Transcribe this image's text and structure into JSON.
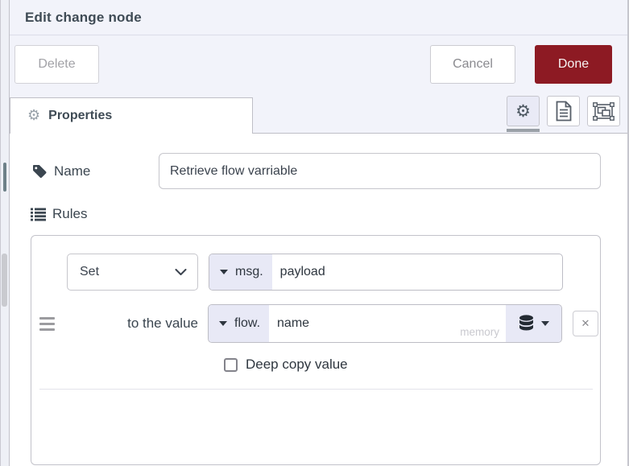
{
  "window": {
    "title": "Edit change node"
  },
  "actions": {
    "delete": "Delete",
    "cancel": "Cancel",
    "done": "Done"
  },
  "tabs": {
    "properties": "Properties"
  },
  "form": {
    "name": {
      "label": "Name",
      "value": "Retrieve flow varriable"
    },
    "rules": {
      "label": "Rules"
    }
  },
  "rule": {
    "action": "Set",
    "target_prefix": "msg.",
    "target_value": "payload",
    "to_label": "to the value",
    "source_prefix": "flow.",
    "source_value": "name",
    "store_hint": "memory",
    "deep_copy_label": "Deep copy value",
    "deep_copy_checked": false
  },
  "icons": {
    "gear": "⚙",
    "close": "✕"
  },
  "colors": {
    "accent_red": "#8D1A23",
    "panel_bg": "#F2F3FA",
    "prefix_bg": "#E8E9F6",
    "border": "#C2C2CA"
  }
}
